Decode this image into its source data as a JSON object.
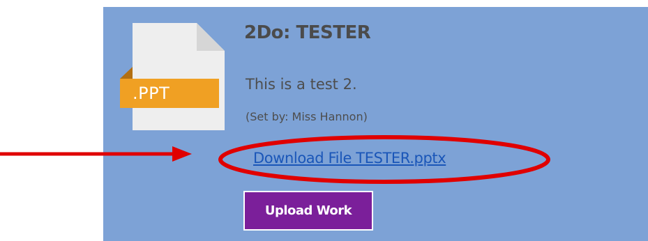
{
  "card": {
    "file_icon": {
      "icon": "ppt-file-icon",
      "extension_label": ".PPT",
      "paper_color": "#eeeeee",
      "fold_color": "#d8d8d8",
      "band_color": "#f0a023"
    },
    "title": "2Do: TESTER",
    "description": "This is a test 2.",
    "set_by": "(Set by: Miss Hannon)",
    "download_link": "Download File TESTER.pptx",
    "upload_button": "Upload Work"
  },
  "colors": {
    "card_background": "#7da2d6",
    "link": "#1a56b8",
    "upload_button": "#7b1f9a",
    "annotation": "#e00000"
  },
  "annotation": {
    "arrow_icon": "red-arrow-icon",
    "ellipse_icon": "red-ellipse-highlight-icon"
  }
}
